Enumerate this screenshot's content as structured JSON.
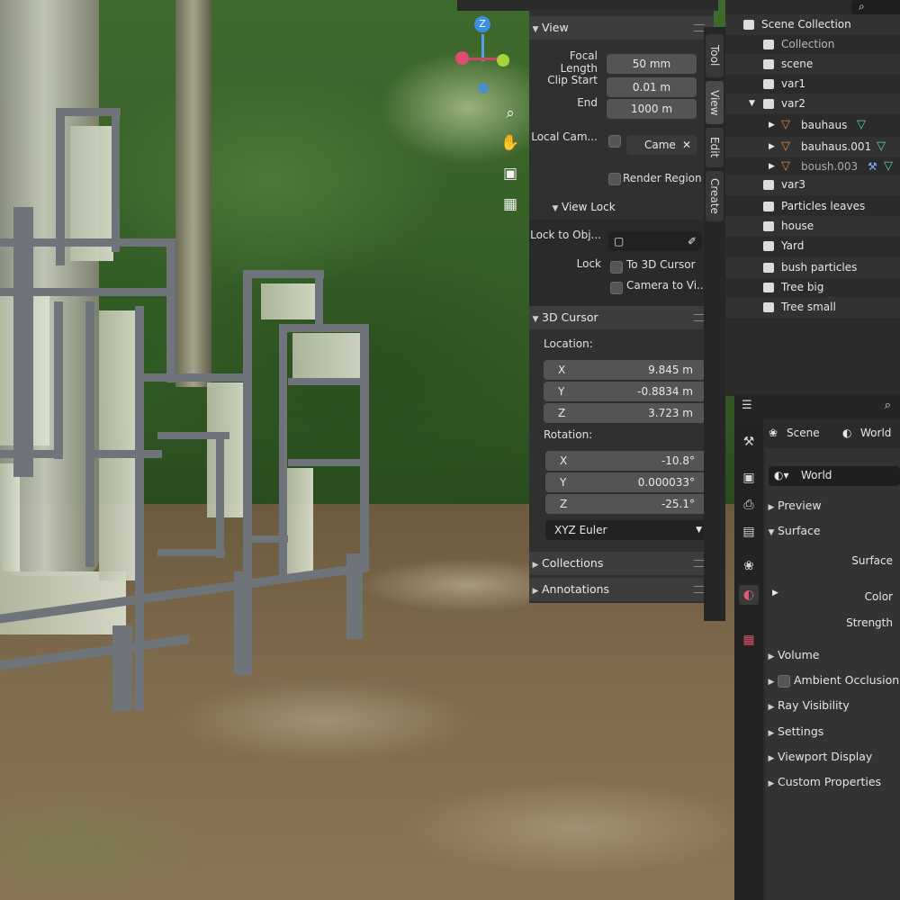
{
  "n_panel": {
    "view_header": "View",
    "focal_length_label": "Focal Length",
    "focal_length_value": "50 mm",
    "clip_start_label": "Clip Start",
    "clip_start_value": "0.01 m",
    "end_label": "End",
    "end_value": "1000 m",
    "local_camera_label": "Local Cam...",
    "local_camera_field": "Came",
    "render_region_label": "Render Region",
    "view_lock_header": "View Lock",
    "lock_to_object_label": "Lock to Obj...",
    "lock_label": "Lock",
    "to_3d_cursor_label": "To 3D Cursor",
    "camera_to_view_label": "Camera to Vi...",
    "cursor_header": "3D Cursor",
    "location_label": "Location:",
    "location": [
      {
        "axis": "X",
        "value": "9.845 m"
      },
      {
        "axis": "Y",
        "value": "-0.8834 m"
      },
      {
        "axis": "Z",
        "value": "3.723 m"
      }
    ],
    "rotation_label": "Rotation:",
    "rotation": [
      {
        "axis": "X",
        "value": "-10.8°"
      },
      {
        "axis": "Y",
        "value": "0.000033°"
      },
      {
        "axis": "Z",
        "value": "-25.1°"
      }
    ],
    "rotation_mode": "XYZ Euler",
    "collections_header": "Collections",
    "annotations_header": "Annotations"
  },
  "vertical_tabs": [
    "Tool",
    "View",
    "Edit",
    "Create"
  ],
  "outliner": {
    "items": [
      {
        "label": "Scene Collection"
      },
      {
        "label": "Collection"
      },
      {
        "label": "scene"
      },
      {
        "label": "var1"
      },
      {
        "label": "var2"
      },
      {
        "label": "bauhaus"
      },
      {
        "label": "bauhaus.001"
      },
      {
        "label": "boush.003"
      },
      {
        "label": "var3"
      },
      {
        "label": "Particles leaves"
      },
      {
        "label": "house"
      },
      {
        "label": "Yard"
      },
      {
        "label": "bush particles"
      },
      {
        "label": "Tree big"
      },
      {
        "label": "Tree small"
      }
    ]
  },
  "properties": {
    "scene_label": "Scene",
    "world_label": "World",
    "world_datablock": "World",
    "preview": "Preview",
    "surface_header": "Surface",
    "surface_label": "Surface",
    "color_label": "Color",
    "strength_label": "Strength",
    "volume": "Volume",
    "ambient_occlusion": "Ambient Occlusion",
    "ray_visibility": "Ray Visibility",
    "settings": "Settings",
    "viewport_display": "Viewport Display",
    "custom_properties": "Custom Properties"
  },
  "gizmo": {
    "z_label": "Z"
  },
  "colors": {
    "panel_bg": "#303030",
    "field_bg": "#545454",
    "mesh_accent": "#58d0c0",
    "object_accent": "#e8864a"
  }
}
